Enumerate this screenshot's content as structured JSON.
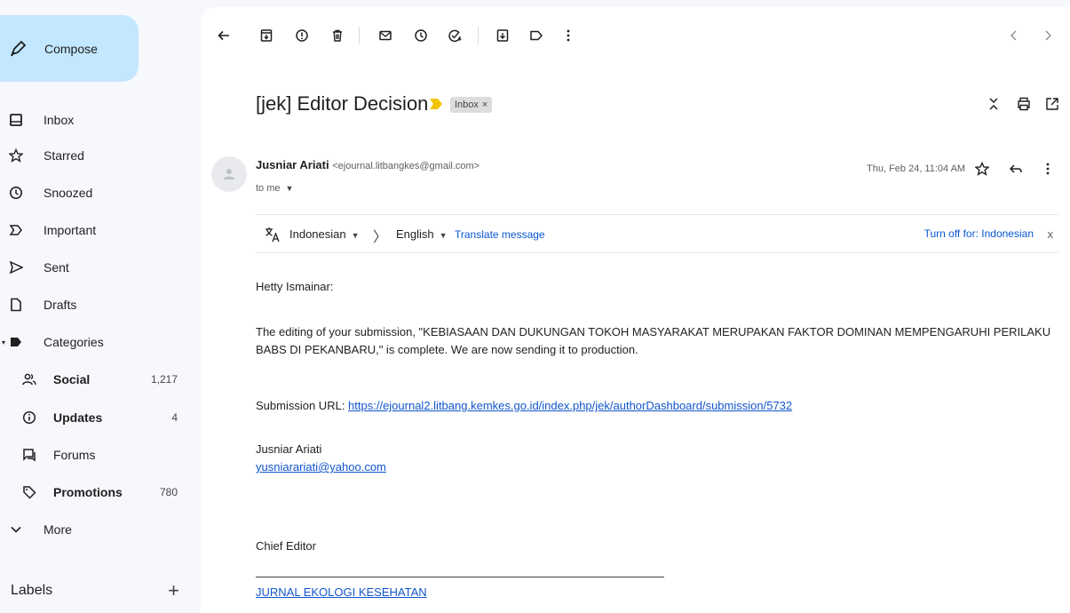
{
  "sidebar": {
    "compose_label": "Compose",
    "items": [
      {
        "label": "Inbox",
        "icon": "inbox-icon"
      },
      {
        "label": "Starred",
        "icon": "star-icon"
      },
      {
        "label": "Snoozed",
        "icon": "clock-icon"
      },
      {
        "label": "Important",
        "icon": "important-icon"
      },
      {
        "label": "Sent",
        "icon": "send-icon"
      },
      {
        "label": "Drafts",
        "icon": "draft-icon"
      },
      {
        "label": "Categories",
        "icon": "label-icon"
      },
      {
        "label": "Social",
        "icon": "people-icon",
        "count": "1,217"
      },
      {
        "label": "Updates",
        "icon": "info-icon",
        "count": "4"
      },
      {
        "label": "Forums",
        "icon": "forum-icon"
      },
      {
        "label": "Promotions",
        "icon": "tag-icon",
        "count": "780"
      },
      {
        "label": "More",
        "icon": "chevron-down-icon"
      }
    ],
    "labels_heading": "Labels",
    "labels_add": "+"
  },
  "toolbar": {
    "icons": [
      "back-arrow-icon",
      "archive-icon",
      "report-spam-icon",
      "delete-icon",
      "mark-unread-icon",
      "snooze-icon",
      "add-task-icon",
      "move-to-icon",
      "label-as-icon",
      "more-vert-icon",
      "newer-chevron-icon",
      "older-chevron-icon"
    ]
  },
  "message": {
    "subject": "[jek] Editor Decision",
    "chip_label": "Inbox",
    "chip_close": "×",
    "sender_name": "Jusniar Ariati",
    "sender_email": "<ejournal.litbangkes@gmail.com>",
    "to_line": "to me",
    "date": "Thu, Feb 24, 11:04 AM"
  },
  "translate": {
    "from_lang": "Indonesian",
    "arrow": "〉",
    "to_lang": "English",
    "action": "Translate message",
    "turn_off": "Turn off for: Indonesian",
    "close": "x"
  },
  "body": {
    "greeting": "Hetty Ismainar:",
    "para1": "The editing of your submission, \"KEBIASAAN DAN DUKUNGAN TOKOH MASYARAKAT MERUPAKAN FAKTOR DOMINAN MEMPENGARUHI PERILAKU BABS DI PEKANBARU,\" is complete. We are now sending it to production.",
    "submission_url_label": "Submission URL: ",
    "submission_url": "https://ejournal2.litbang.kemkes.go.id/index.php/jek/authorDashboard/submission/5732",
    "sig_name": "Jusniar Ariati",
    "sig_email": "yusniarariati@yahoo.com",
    "chief": "Chief Editor",
    "journal": "JURNAL EKOLOGI KESEHATAN"
  },
  "colors": {
    "compose_bg": "#c2e7ff",
    "link": "#1155cc",
    "important_marker": "#f2c200"
  }
}
